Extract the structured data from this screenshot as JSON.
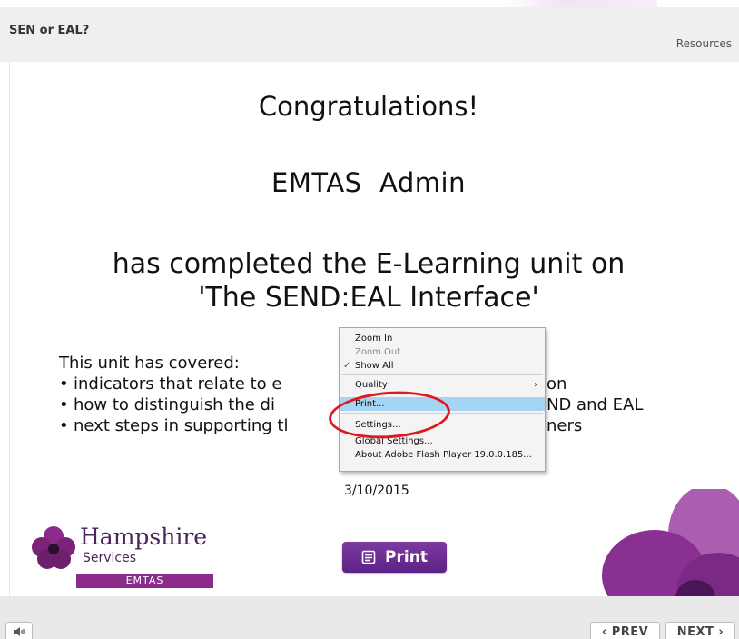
{
  "header": {
    "title": "SEN or EAL?",
    "resources": "Resources"
  },
  "certificate": {
    "heading": "Congratulations!",
    "name": "EMTAS  Admin",
    "completed_line1": "has completed the E-Learning unit on",
    "completed_line2": "'The SEND:EAL Interface'",
    "covered_heading": "This unit has covered:",
    "covered_items": [
      "indicators that relate to e",
      "how to distinguish the di",
      "next steps in supporting tl"
    ],
    "covered_tails": [
      "on",
      "ND and EAL",
      "ners"
    ],
    "date": "3/10/2015",
    "print_label": "Print"
  },
  "logo": {
    "name": "Hampshire",
    "services": "Services",
    "dept": "EMTAS"
  },
  "context_menu": {
    "items": [
      {
        "label": "Zoom In"
      },
      {
        "label": "Zoom Out"
      },
      {
        "label": "Show All"
      },
      {
        "label": "Quality"
      },
      {
        "label": "Print..."
      },
      {
        "label": "Settings..."
      },
      {
        "label": "Global Settings..."
      },
      {
        "label": "About Adobe Flash Player 19.0.0.185..."
      }
    ]
  },
  "footer": {
    "prev_label": "PREV",
    "next_label": "NEXT"
  },
  "colors": {
    "brand_purple": "#5c2386",
    "highlight": "#a6d4f5",
    "annotation_red": "#e0171d"
  }
}
